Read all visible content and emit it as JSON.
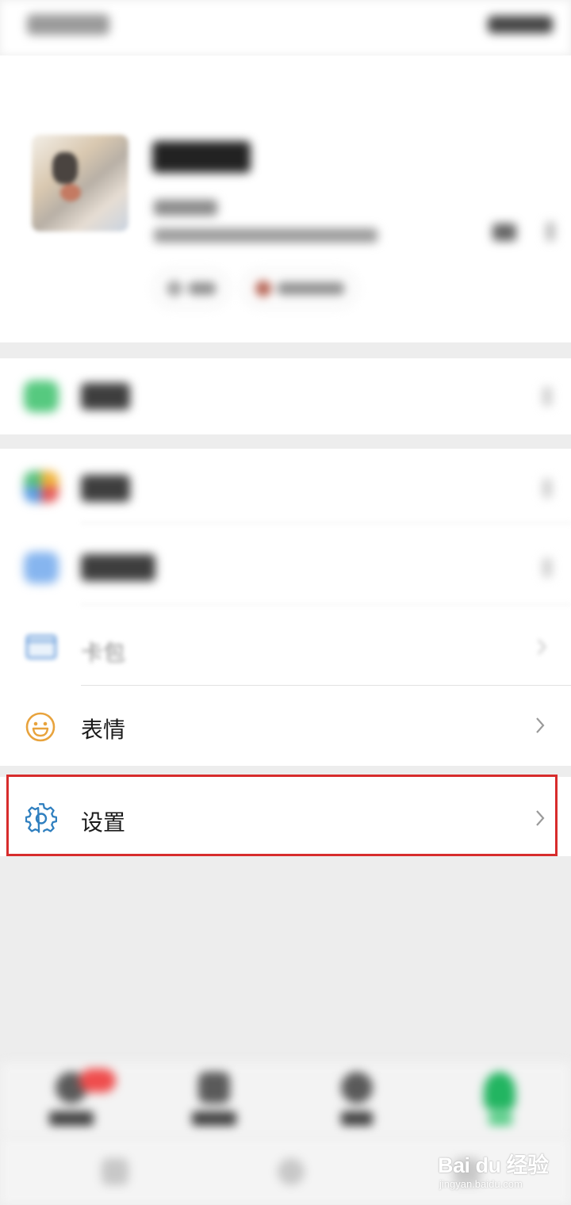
{
  "status_bar": {
    "time": "",
    "icons": ""
  },
  "profile": {
    "nickname": "",
    "wechat_id": "",
    "status": ""
  },
  "menu": {
    "pay": {
      "label": "",
      "icon": "wechat-pay-icon"
    },
    "favorites": {
      "label": "",
      "icon": "favorites-icon"
    },
    "album": {
      "label": "",
      "icon": "album-icon"
    },
    "cards": {
      "label": "卡包",
      "icon": "card-wallet-icon"
    },
    "stickers": {
      "label": "表情",
      "icon": "smiley-icon"
    },
    "settings": {
      "label": "设置",
      "icon": "gear-icon"
    }
  },
  "tabbar": {
    "tabs": [
      {
        "name": "chats",
        "icon": "chat-icon",
        "has_badge": true
      },
      {
        "name": "contacts",
        "icon": "contacts-icon",
        "has_badge": false
      },
      {
        "name": "discover",
        "icon": "discover-icon",
        "has_badge": false
      },
      {
        "name": "me",
        "icon": "person-icon",
        "active": true
      }
    ]
  },
  "watermark": {
    "main": "Bai du 经验",
    "sub": "jingyan.baidu.com"
  },
  "colors": {
    "highlight_border": "#d72c2c",
    "accent_green": "#07c160",
    "settings_icon": "#2f7fbf",
    "sticker_icon": "#e8a33d",
    "badge": "#ef4d4d"
  }
}
